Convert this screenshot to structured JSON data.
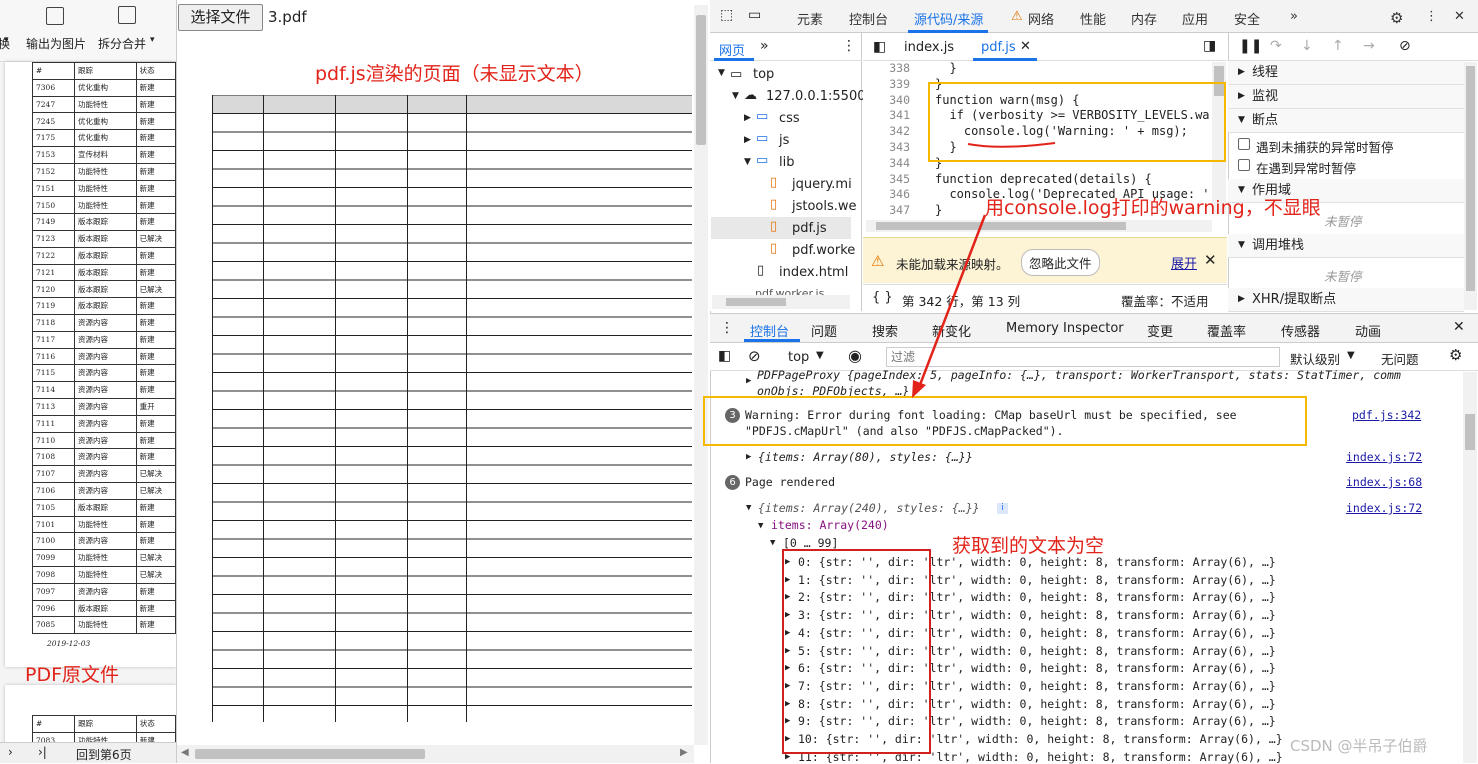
{
  "left_viewer": {
    "toolbar": {
      "partial_label": "换",
      "export_image_label": "输出为图片",
      "split_merge_label": "拆分合并"
    },
    "table_header": [
      "#",
      "跟踪",
      "状态"
    ],
    "rows": [
      [
        "7306",
        "优化重构",
        "新建"
      ],
      [
        "7247",
        "功能特性",
        "新建"
      ],
      [
        "7245",
        "优化重构",
        "新建"
      ],
      [
        "7175",
        "优化重构",
        "新建"
      ],
      [
        "7153",
        "宣传材料",
        "新建"
      ],
      [
        "7152",
        "功能特性",
        "新建"
      ],
      [
        "7151",
        "功能特性",
        "新建"
      ],
      [
        "7150",
        "功能特性",
        "新建"
      ],
      [
        "7149",
        "版本跟踪",
        "新建"
      ],
      [
        "7123",
        "版本跟踪",
        "已解决"
      ],
      [
        "7122",
        "版本跟踪",
        "新建"
      ],
      [
        "7121",
        "版本跟踪",
        "新建"
      ],
      [
        "7120",
        "版本跟踪",
        "已解决"
      ],
      [
        "7119",
        "版本跟踪",
        "新建"
      ],
      [
        "7118",
        "资源内容",
        "新建"
      ],
      [
        "7117",
        "资源内容",
        "新建"
      ],
      [
        "7116",
        "资源内容",
        "新建"
      ],
      [
        "7115",
        "资源内容",
        "新建"
      ],
      [
        "7114",
        "资源内容",
        "新建"
      ],
      [
        "7113",
        "资源内容",
        "重开"
      ],
      [
        "7111",
        "资源内容",
        "新建"
      ],
      [
        "7110",
        "资源内容",
        "新建"
      ],
      [
        "7108",
        "资源内容",
        "新建"
      ],
      [
        "7107",
        "资源内容",
        "已解决"
      ],
      [
        "7106",
        "资源内容",
        "已解决"
      ],
      [
        "7105",
        "版本跟踪",
        "新建"
      ],
      [
        "7101",
        "功能特性",
        "新建"
      ],
      [
        "7100",
        "资源内容",
        "新建"
      ],
      [
        "7099",
        "功能特性",
        "已解决"
      ],
      [
        "7098",
        "功能特性",
        "已解决"
      ],
      [
        "7097",
        "资源内容",
        "新建"
      ],
      [
        "7096",
        "版本跟踪",
        "新建"
      ],
      [
        "7085",
        "功能特性",
        "新建"
      ]
    ],
    "date": "2019-12-03",
    "page2_header": [
      "#",
      "跟踪",
      "状态"
    ],
    "page2_row": [
      "7083",
      "功能特性",
      "新建"
    ],
    "status_goto": "回到第6页",
    "annotation": "PDF原文件"
  },
  "middle": {
    "file_button": "选择文件",
    "file_name": "3.pdf",
    "annotation": "pdf.js渲染的页面（未显示文本）"
  },
  "devtools": {
    "tabs": [
      "元素",
      "控制台",
      "源代码/来源",
      "网络",
      "性能",
      "内存",
      "应用",
      "安全"
    ],
    "active_tab": "源代码/来源",
    "nav_tab": "网页",
    "tree": [
      "top",
      "127.0.0.1:5500",
      "css",
      "js",
      "lib",
      "jquery.mi",
      "jstools.we",
      "pdf.js",
      "pdf.worke",
      "index.html",
      "pdf.worker.js"
    ],
    "file_tabs": [
      "index.js",
      "pdf.js"
    ],
    "active_file": "pdf.js",
    "code_lines": [
      {
        "n": "338",
        "t": "  }"
      },
      {
        "n": "339",
        "t": "}"
      },
      {
        "n": "340",
        "t": "function warn(msg) {"
      },
      {
        "n": "341",
        "t": "  if (verbosity >= VERBOSITY_LEVELS.wa"
      },
      {
        "n": "342",
        "t": "    console.log('Warning: ' + msg);"
      },
      {
        "n": "343",
        "t": "  }"
      },
      {
        "n": "344",
        "t": "}"
      },
      {
        "n": "345",
        "t": "function deprecated(details) {"
      },
      {
        "n": "346",
        "t": "  console.log('Deprecated API usage: '"
      },
      {
        "n": "347",
        "t": "}"
      }
    ],
    "sourcemap_msg": "未能加载来源映射。",
    "ignore_file": "忽略此文件",
    "expand": "展开",
    "cursor_pos": "第 342 行，第 13 列",
    "coverage": "覆盖率：不适用",
    "debugger_sections": [
      "线程",
      "监视",
      "断点",
      "作用域",
      "调用堆栈",
      "XHR/提取断点"
    ],
    "bp_uncaught": "遇到未捕获的异常时暂停",
    "bp_caught": "在遇到异常时暂停",
    "not_paused": "未暂停",
    "drawer_tabs": [
      "控制台",
      "问题",
      "搜索",
      "新变化",
      "Memory Inspector",
      "变更",
      "覆盖率",
      "传感器",
      "动画"
    ],
    "context": "top",
    "filter_placeholder": "过滤",
    "levels": "默认级别",
    "issues": "无问题",
    "console": {
      "pageproxy_line1": "PDFPageProxy {pageIndex: 5, pageInfo: {…}, transport: WorkerTransport, stats: StatTimer, comm",
      "pageproxy_line2": "onObjs: PDFObjects, …}",
      "warning_count": "3",
      "warning_line1": "Warning: Error during font loading: CMap baseUrl must be specified, see",
      "warning_line2": "\"PDFJS.cMapUrl\" (and also \"PDFJS.cMapPacked\").",
      "warning_src": "pdf.js:342",
      "items80": "{items: Array(80), styles: {…}}",
      "items80_src": "index.js:72",
      "rendered_count": "6",
      "rendered": "Page rendered",
      "rendered_src": "index.js:68",
      "items240": "{items: Array(240), styles: {…}}",
      "items240_src": "index.js:72",
      "items_label": "items: Array(240)",
      "range": "[0 … 99]",
      "item_rows": [
        "0: {str: '', dir: 'ltr', width: 0, height: 8, transform: Array(6), …}",
        "1: {str: '', dir: 'ltr', width: 0, height: 8, transform: Array(6), …}",
        "2: {str: '', dir: 'ltr', width: 0, height: 8, transform: Array(6), …}",
        "3: {str: '', dir: 'ltr', width: 0, height: 8, transform: Array(6), …}",
        "4: {str: '', dir: 'ltr', width: 0, height: 8, transform: Array(6), …}",
        "5: {str: '', dir: 'ltr', width: 0, height: 8, transform: Array(6), …}",
        "6: {str: '', dir: 'ltr', width: 0, height: 8, transform: Array(6), …}",
        "7: {str: '', dir: 'ltr', width: 0, height: 8, transform: Array(6), …}",
        "8: {str: '', dir: 'ltr', width: 0, height: 8, transform: Array(6), …}",
        "9: {str: '', dir: 'ltr', width: 0, height: 8, transform: Array(6), …}",
        "10: {str: '', dir: 'ltr', width: 0, height: 8, transform: Array(6), …}",
        "11: {str: '', dir: 'ltr', width: 0, height: 8, transform: Array(6), …}"
      ]
    },
    "annotation_warning": "用console.log打印的warning，不显眼",
    "annotation_empty": "获取到的文本为空"
  },
  "watermark": "CSDN @半吊子伯爵",
  "colors": {
    "annotation": "#e2231a",
    "yellow_box": "#f5b800",
    "red_box": "#d21f1f",
    "accent": "#1a73e8"
  }
}
